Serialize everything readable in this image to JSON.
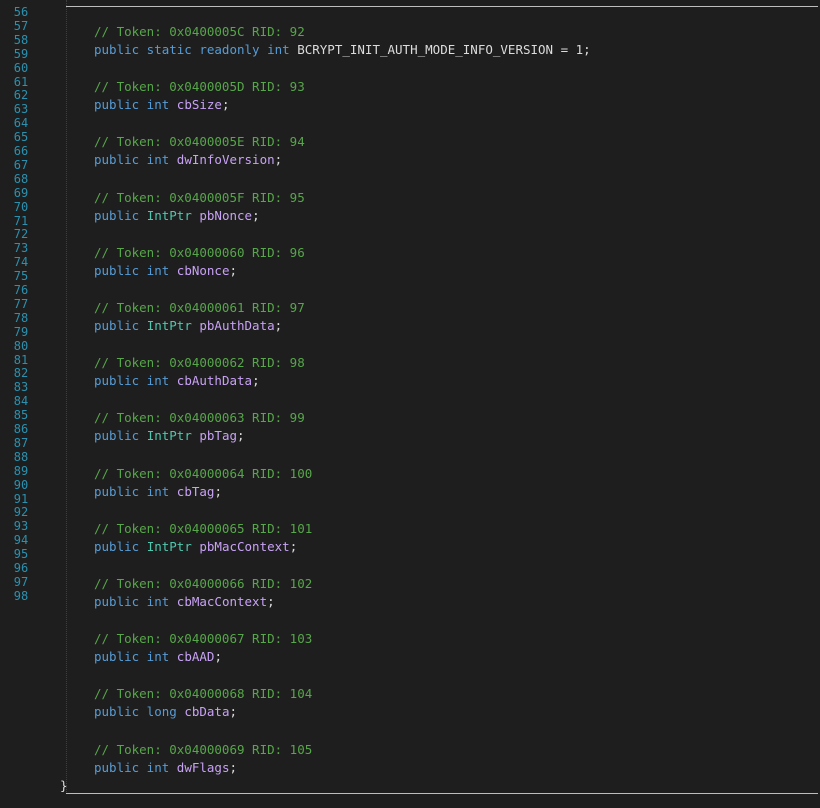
{
  "gutter": {
    "lines": [
      "56",
      "57",
      "58",
      "59",
      "60",
      "61",
      "62",
      "63",
      "64",
      "65",
      "66",
      "67",
      "68",
      "69",
      "70",
      "71",
      "72",
      "73",
      "74",
      "75",
      "76",
      "77",
      "78",
      "79",
      "80",
      "81",
      "82",
      "83",
      "84",
      "85",
      "86",
      "87",
      "88",
      "89",
      "90",
      "91",
      "92",
      "93",
      "94",
      "95",
      "96",
      "97",
      "98"
    ]
  },
  "code": {
    "brace": "}",
    "fields": [
      {
        "comment": "// Token: 0x0400005C RID: 92",
        "prefix": "public static readonly int ",
        "type": "",
        "name": "BCRYPT_INIT_AUTH_MODE_INFO_VERSION",
        "suffix": " = 1;"
      },
      {
        "comment": "// Token: 0x0400005D RID: 93",
        "prefix": "public int ",
        "type": "",
        "name": "cbSize",
        "suffix": ";"
      },
      {
        "comment": "// Token: 0x0400005E RID: 94",
        "prefix": "public int ",
        "type": "",
        "name": "dwInfoVersion",
        "suffix": ";"
      },
      {
        "comment": "// Token: 0x0400005F RID: 95",
        "prefix": "public ",
        "type": "IntPtr",
        "name": "pbNonce",
        "suffix": ";"
      },
      {
        "comment": "// Token: 0x04000060 RID: 96",
        "prefix": "public int ",
        "type": "",
        "name": "cbNonce",
        "suffix": ";"
      },
      {
        "comment": "// Token: 0x04000061 RID: 97",
        "prefix": "public ",
        "type": "IntPtr",
        "name": "pbAuthData",
        "suffix": ";"
      },
      {
        "comment": "// Token: 0x04000062 RID: 98",
        "prefix": "public int ",
        "type": "",
        "name": "cbAuthData",
        "suffix": ";"
      },
      {
        "comment": "// Token: 0x04000063 RID: 99",
        "prefix": "public ",
        "type": "IntPtr",
        "name": "pbTag",
        "suffix": ";"
      },
      {
        "comment": "// Token: 0x04000064 RID: 100",
        "prefix": "public int ",
        "type": "",
        "name": "cbTag",
        "suffix": ";"
      },
      {
        "comment": "// Token: 0x04000065 RID: 101",
        "prefix": "public ",
        "type": "IntPtr",
        "name": "pbMacContext",
        "suffix": ";"
      },
      {
        "comment": "// Token: 0x04000066 RID: 102",
        "prefix": "public int ",
        "type": "",
        "name": "cbMacContext",
        "suffix": ";"
      },
      {
        "comment": "// Token: 0x04000067 RID: 103",
        "prefix": "public int ",
        "type": "",
        "name": "cbAAD",
        "suffix": ";"
      },
      {
        "comment": "// Token: 0x04000068 RID: 104",
        "prefix": "public long ",
        "type": "",
        "name": "cbData",
        "suffix": ";"
      },
      {
        "comment": "// Token: 0x04000069 RID: 105",
        "prefix": "public int ",
        "type": "",
        "name": "dwFlags",
        "suffix": ";"
      }
    ]
  },
  "colors": {
    "background": "#1e1e1e",
    "line_number": "#2b91af",
    "comment": "#57a64a",
    "keyword": "#569cd6",
    "type": "#4ec9b0",
    "identifier": "#c8a2f5"
  }
}
